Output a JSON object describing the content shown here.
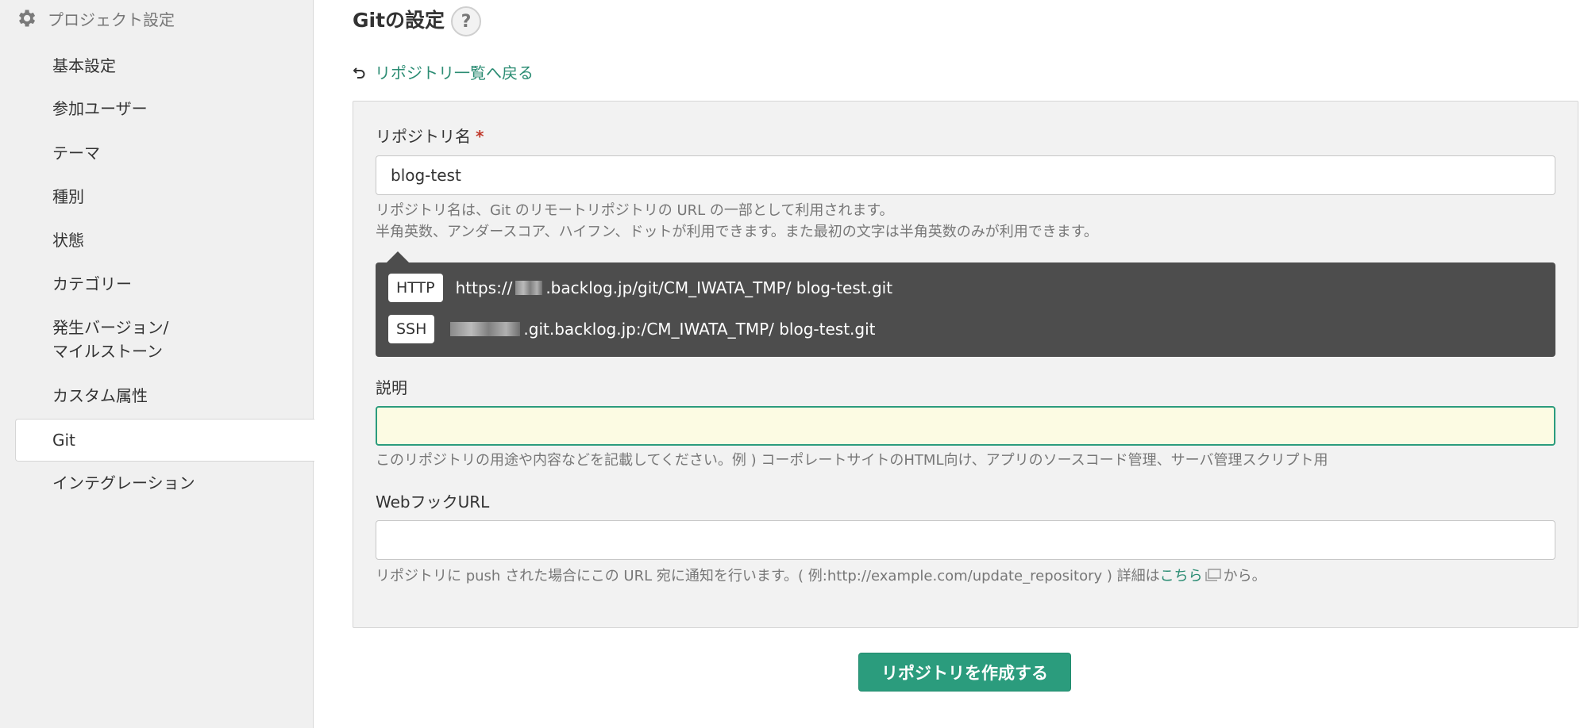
{
  "sidebar": {
    "header": {
      "title": "プロジェクト設定",
      "icon": "gear-icon"
    },
    "items": [
      {
        "label": "基本設定"
      },
      {
        "label": "参加ユーザー"
      },
      {
        "label": "テーマ"
      },
      {
        "label": "種別"
      },
      {
        "label": "状態"
      },
      {
        "label": "カテゴリー"
      },
      {
        "label_line1": "発生バージョン/",
        "label_line2": "マイルストーン"
      },
      {
        "label": "カスタム属性"
      },
      {
        "label": "Git",
        "active": true
      },
      {
        "label": "インテグレーション"
      }
    ]
  },
  "main": {
    "title": "Gitの設定",
    "help_label": "?",
    "back_link": "リポジトリ一覧へ戻る",
    "repo_name": {
      "label": "リポジトリ名",
      "required_mark": "*",
      "value": "blog-test",
      "hint_line1": "リポジトリ名は、Git のリモートリポジトリの URL の一部として利用されます。",
      "hint_line2": "半角英数、アンダースコア、ハイフン、ドットが利用できます。また最初の文字は半角英数のみが利用できます。"
    },
    "urls": {
      "http": {
        "tag": "HTTP",
        "prefix": "https://",
        "suffix": ".backlog.jp/git/CM_IWATA_TMP/ blog-test.git"
      },
      "ssh": {
        "tag": "SSH",
        "suffix": ".git.backlog.jp:/CM_IWATA_TMP/ blog-test.git"
      }
    },
    "description": {
      "label": "説明",
      "value": "",
      "hint": "このリポジトリの用途や内容などを記載してください。例 ) コーポレートサイトのHTML向け、アプリのソースコード管理、サーバ管理スクリプト用"
    },
    "webhook": {
      "label": "WebフックURL",
      "value": "",
      "hint_before": "リポジトリに push された場合にこの URL 宛に通知を行います。( 例:http://example.com/update_repository ) 詳細は",
      "hint_link": "こちら",
      "hint_after": "から。"
    },
    "submit_label": "リポジトリを作成する"
  },
  "colors": {
    "accent": "#2b9c7d",
    "link": "#2b8c73",
    "required": "#c0392b",
    "focused_input_bg": "#fcfbe3",
    "url_box_bg": "#4d4d4d"
  }
}
